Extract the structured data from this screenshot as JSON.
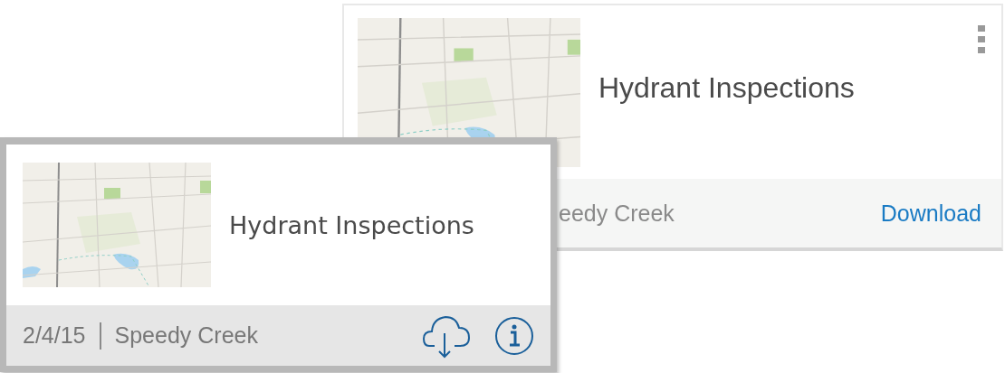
{
  "back_card": {
    "title": "Hydrant Inspections",
    "footer_text": "eedy Creek",
    "action": "Download"
  },
  "front_card": {
    "title": "Hydrant Inspections",
    "date": "2/4/15",
    "location": "Speedy Creek"
  }
}
